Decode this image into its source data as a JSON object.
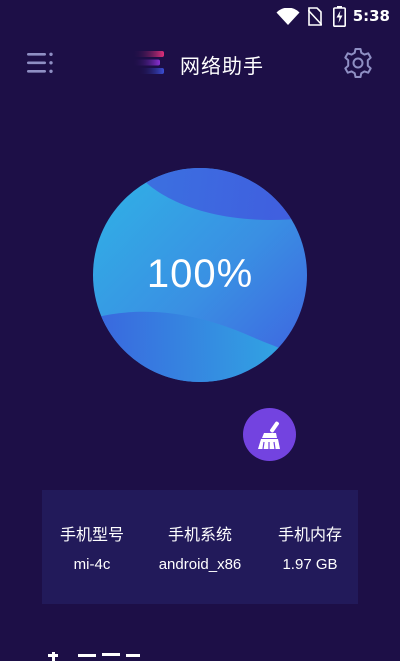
{
  "status_bar": {
    "time": "5:38",
    "icons": [
      "wifi-icon",
      "no-sim-icon",
      "battery-charging-icon"
    ]
  },
  "app_bar": {
    "title": "网络助手",
    "menu_icon": "menu-icon",
    "settings_icon": "gear-icon"
  },
  "speed": {
    "percent": "100%",
    "progress": 1.0
  },
  "clean_button": {
    "icon": "broom-icon"
  },
  "device_info": {
    "model_label": "手机型号",
    "model_value": "mi-4c",
    "system_label": "手机系统",
    "system_value": "android_x86",
    "memory_label": "手机内存",
    "memory_value": "1.97 GB"
  },
  "colors": {
    "background": "#1d0f47",
    "panel": "#221a5a",
    "ball_light": "#2cb6e3",
    "ball_dark": "#3d5fdf",
    "clean_button": "#7343e0",
    "logo_pink": "#e0307a",
    "logo_blue": "#3b4fd6"
  }
}
